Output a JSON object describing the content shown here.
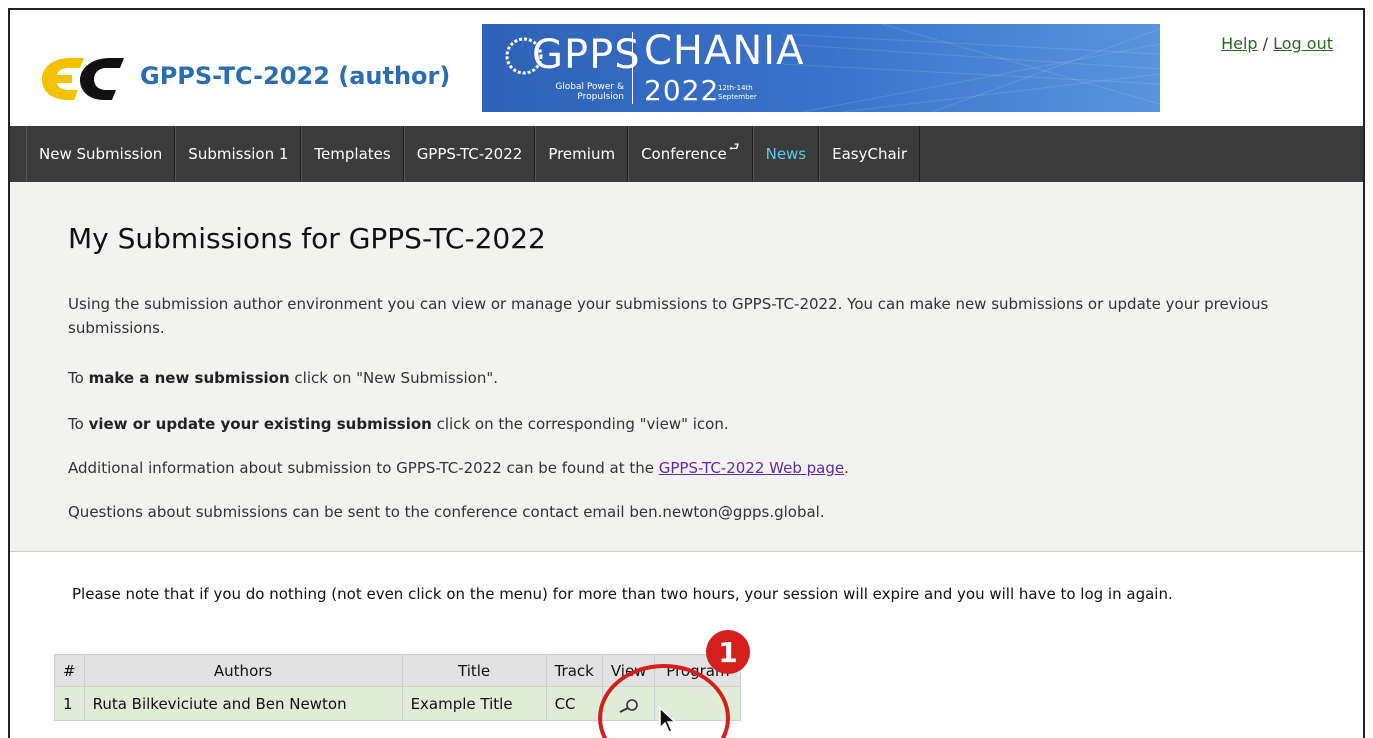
{
  "header": {
    "app_title": "GPPS-TC-2022 (author)",
    "banner": {
      "brand": "GPPS",
      "subtitle_line1": "Global Power &",
      "subtitle_line2": "Propulsion",
      "city": "CHANIA",
      "year": "2022",
      "dates_line1": "12th-14th",
      "dates_line2": "September"
    },
    "links": {
      "help": "Help",
      "separator": "/",
      "logout": "Log out"
    }
  },
  "menu": {
    "items": [
      {
        "label": "New Submission"
      },
      {
        "label": "Submission 1"
      },
      {
        "label": "Templates"
      },
      {
        "label": "GPPS-TC-2022"
      },
      {
        "label": "Premium"
      },
      {
        "label": "Conference"
      },
      {
        "label": "News"
      },
      {
        "label": "EasyChair"
      }
    ],
    "return_glyph": "⮐"
  },
  "intro": {
    "title": "My Submissions for GPPS-TC-2022",
    "p1": "Using the submission author environment you can view or manage your submissions to GPPS-TC-2022. You can make new submissions or update your previous submissions.",
    "p2_pre": "To ",
    "p2_bold": "make a new submission",
    "p2_post": " click on \"New Submission\".",
    "p3_pre": "To ",
    "p3_bold": "view or update your existing submission",
    "p3_post": " click on the corresponding \"view\" icon.",
    "p4_pre": "Additional information about submission to GPPS-TC-2022 can be found at the ",
    "p4_link": "GPPS-TC-2022 Web page",
    "p4_post": ".",
    "p5": "Questions about submissions can be sent to the conference contact email ben.newton@gpps.global."
  },
  "notice": "Please note that if you do nothing (not even click on the menu) for more than two hours, your session will expire and you will have to log in again.",
  "table": {
    "headers": [
      "#",
      "Authors",
      "Title",
      "Track",
      "View",
      "Program"
    ],
    "rows": [
      {
        "num": "1",
        "authors": "Ruta Bilkeviciute and Ben Newton",
        "title": "Example Title",
        "track": "CC",
        "view": "",
        "program": ""
      }
    ]
  },
  "annotation": {
    "badge": "1",
    "color": "#d51e1e"
  },
  "colors": {
    "menu_bg": "#3b3b3b",
    "news_active": "#5ec7f0",
    "row_bg": "#deecd8",
    "title_blue": "#2a6db0"
  }
}
